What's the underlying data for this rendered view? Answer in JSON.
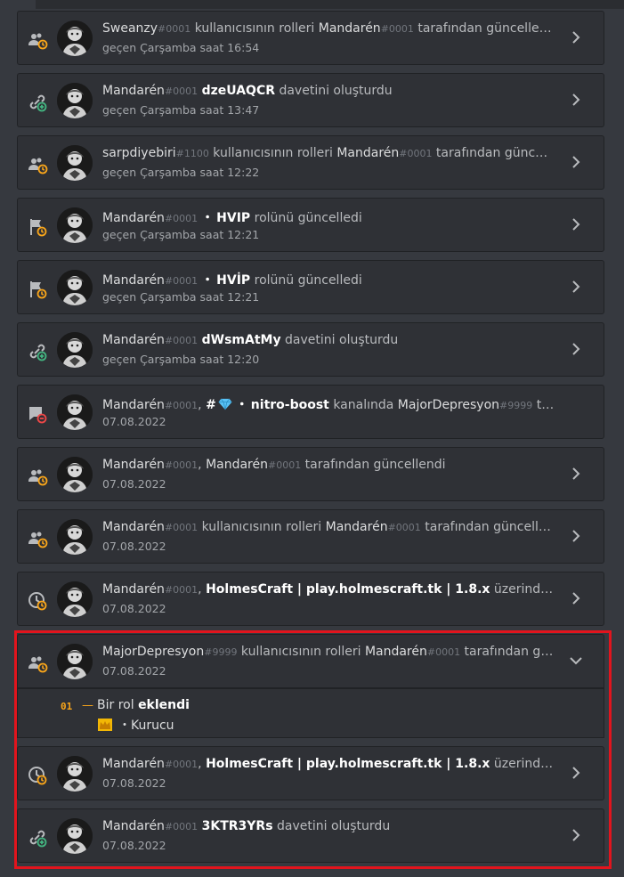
{
  "entries": [
    {
      "parts": [
        {
          "c": "u",
          "v": "Sweanzy"
        },
        {
          "c": "d",
          "v": "#0001"
        },
        {
          "c": "t",
          "v": " kullanıcısının rolleri "
        },
        {
          "c": "u",
          "v": "Mandarén"
        },
        {
          "c": "d",
          "v": "#0001"
        },
        {
          "c": "t",
          "v": " tarafından güncellendi"
        }
      ],
      "time": "geçen Çarşamba saat 16:54",
      "icon": "member-roles-update-icon"
    },
    {
      "parts": [
        {
          "c": "u",
          "v": "Mandarén"
        },
        {
          "c": "d",
          "v": "#0001"
        },
        {
          "c": "t",
          "v": " "
        },
        {
          "c": "b",
          "v": "dzeUAQCR"
        },
        {
          "c": "t",
          "v": " davetini oluşturdu"
        }
      ],
      "time": "geçen Çarşamba saat 13:47",
      "icon": "invite-create-icon"
    },
    {
      "parts": [
        {
          "c": "u",
          "v": "sarpdiyebiri"
        },
        {
          "c": "d",
          "v": "#1100"
        },
        {
          "c": "t",
          "v": " kullanıcısının rolleri "
        },
        {
          "c": "u",
          "v": "Mandarén"
        },
        {
          "c": "d",
          "v": "#0001"
        },
        {
          "c": "t",
          "v": " tarafından güncellendi"
        }
      ],
      "time": "geçen Çarşamba saat 12:22",
      "icon": "member-roles-update-icon"
    },
    {
      "parts": [
        {
          "c": "u",
          "v": "Mandarén"
        },
        {
          "c": "d",
          "v": "#0001"
        },
        {
          "c": "dot",
          "v": "・"
        },
        {
          "c": "b",
          "v": "HVIP"
        },
        {
          "c": "t",
          "v": " rolünü güncelledi"
        }
      ],
      "time": "geçen Çarşamba saat 12:21",
      "icon": "role-update-icon"
    },
    {
      "parts": [
        {
          "c": "u",
          "v": "Mandarén"
        },
        {
          "c": "d",
          "v": "#0001"
        },
        {
          "c": "dot",
          "v": "・"
        },
        {
          "c": "b",
          "v": "HVİP"
        },
        {
          "c": "t",
          "v": " rolünü güncelledi"
        }
      ],
      "time": "geçen Çarşamba saat 12:21",
      "icon": "role-update-icon"
    },
    {
      "parts": [
        {
          "c": "u",
          "v": "Mandarén"
        },
        {
          "c": "d",
          "v": "#0001"
        },
        {
          "c": "t",
          "v": " "
        },
        {
          "c": "b",
          "v": "dWsmAtMy"
        },
        {
          "c": "t",
          "v": " davetini oluşturdu"
        }
      ],
      "time": "geçen Çarşamba saat 12:20",
      "icon": "invite-create-icon"
    },
    {
      "parts": [
        {
          "c": "u",
          "v": "Mandarén"
        },
        {
          "c": "d",
          "v": "#0001"
        },
        {
          "c": "t",
          "v": ", "
        },
        {
          "c": "b",
          "v": "#"
        },
        {
          "c": "diamond",
          "v": ""
        },
        {
          "c": "dot",
          "v": "・"
        },
        {
          "c": "b",
          "v": "nitro-boost"
        },
        {
          "c": "t",
          "v": " kanalında "
        },
        {
          "c": "u",
          "v": "MajorDepresyon"
        },
        {
          "c": "d",
          "v": "#9999"
        },
        {
          "c": "t",
          "v": " tarafın..."
        }
      ],
      "time": "07.08.2022",
      "icon": "channel-overwrite-delete-icon",
      "nochev": true
    },
    {
      "parts": [
        {
          "c": "u",
          "v": "Mandarén"
        },
        {
          "c": "d",
          "v": "#0001"
        },
        {
          "c": "t",
          "v": ", "
        },
        {
          "c": "u",
          "v": "Mandarén"
        },
        {
          "c": "d",
          "v": "#0001"
        },
        {
          "c": "t",
          "v": " tarafından güncellendi"
        }
      ],
      "time": "07.08.2022",
      "icon": "member-roles-update-icon"
    },
    {
      "parts": [
        {
          "c": "u",
          "v": "Mandarén"
        },
        {
          "c": "d",
          "v": "#0001"
        },
        {
          "c": "t",
          "v": " kullanıcısının rolleri "
        },
        {
          "c": "u",
          "v": "Mandarén"
        },
        {
          "c": "d",
          "v": "#0001"
        },
        {
          "c": "t",
          "v": " tarafından güncellendi"
        }
      ],
      "time": "07.08.2022",
      "icon": "member-roles-update-icon"
    },
    {
      "parts": [
        {
          "c": "u",
          "v": "Mandarén"
        },
        {
          "c": "d",
          "v": "#0001"
        },
        {
          "c": "t",
          "v": ", "
        },
        {
          "c": "b",
          "v": "HolmesCraft | play.holmescraft.tk | 1.8.x"
        },
        {
          "c": "t",
          "v": " üzerinde değişikli..."
        }
      ],
      "time": "07.08.2022",
      "icon": "guild-update-icon"
    },
    {
      "parts": [
        {
          "c": "u",
          "v": "MajorDepresyon"
        },
        {
          "c": "d",
          "v": "#9999"
        },
        {
          "c": "t",
          "v": " kullanıcısının rolleri "
        },
        {
          "c": "u",
          "v": "Mandarén"
        },
        {
          "c": "d",
          "v": "#0001"
        },
        {
          "c": "t",
          "v": " tarafından günce..."
        }
      ],
      "time": "07.08.2022",
      "icon": "member-roles-update-icon",
      "expanded": true
    },
    {
      "parts": [
        {
          "c": "u",
          "v": "Mandarén"
        },
        {
          "c": "d",
          "v": "#0001"
        },
        {
          "c": "t",
          "v": ", "
        },
        {
          "c": "b",
          "v": "HolmesCraft | play.holmescraft.tk | 1.8.x"
        },
        {
          "c": "t",
          "v": " üzerinde değişikli..."
        }
      ],
      "time": "07.08.2022",
      "icon": "guild-update-icon"
    },
    {
      "parts": [
        {
          "c": "u",
          "v": "Mandarén"
        },
        {
          "c": "d",
          "v": "#0001"
        },
        {
          "c": "t",
          "v": " "
        },
        {
          "c": "b",
          "v": "3KTR3YRs"
        },
        {
          "c": "t",
          "v": " davetini oluşturdu"
        }
      ],
      "time": "07.08.2022",
      "icon": "invite-create-icon"
    }
  ],
  "expanded_detail": {
    "num": "01",
    "dash": "—",
    "action_prefix": "Bir rol ",
    "action_bold": "eklendi",
    "role_sep": "・",
    "role_name": "Kurucu"
  },
  "colors": {
    "accent_update": "#faa61a",
    "accent_create": "#43b581",
    "accent_delete": "#f04747",
    "highlight": "#e2141d"
  }
}
